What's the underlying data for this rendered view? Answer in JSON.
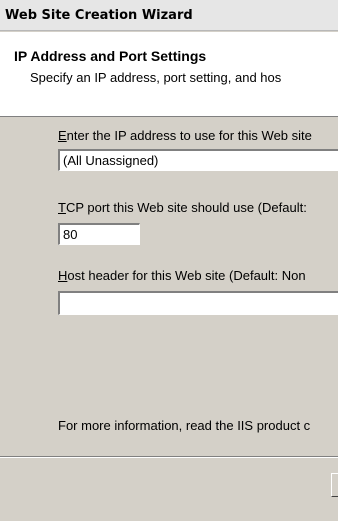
{
  "window": {
    "title": "Web Site Creation Wizard"
  },
  "header": {
    "title": "IP Address and Port Settings",
    "subtitle": "Specify an IP address, port setting, and hos"
  },
  "ip": {
    "label_accel": "E",
    "label_rest": "nter the IP address to use for this Web site",
    "value": "(All Unassigned)"
  },
  "port": {
    "label_accel": "T",
    "label_rest": "CP port this Web site should use (Default:",
    "value": "80"
  },
  "host": {
    "label_accel": "H",
    "label_rest": "ost header for this Web site (Default: Non",
    "value": ""
  },
  "info_text": "For more information, read the IIS product c"
}
